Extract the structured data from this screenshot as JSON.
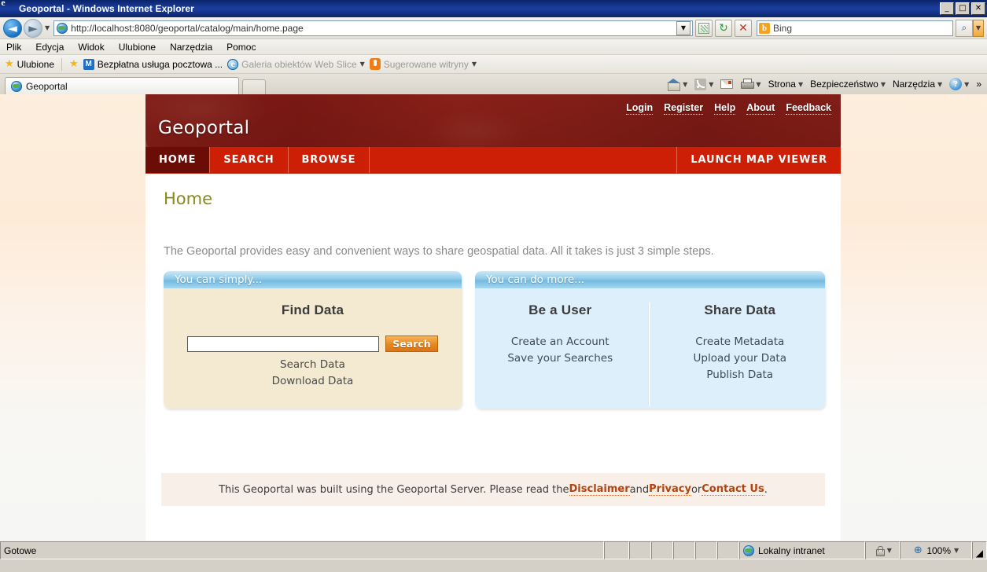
{
  "window": {
    "title": "Geoportal - Windows Internet Explorer",
    "icon": "ie-icon",
    "controls": {
      "minimize": "_",
      "maximize": "□",
      "close": "✕"
    }
  },
  "browser": {
    "address": {
      "url": "http://localhost:8080/geoportal/catalog/main/home.page",
      "dropdown_caret": "▼",
      "site_icon": "globe-icon"
    },
    "nav": {
      "back": "◄",
      "forward": "►",
      "history_caret": "▼"
    },
    "toolbuttons": {
      "compatibility": "compatibility-view-icon",
      "refresh": "↻",
      "stop": "✕"
    },
    "search": {
      "provider": "Bing",
      "provider_initial": "b",
      "go": "⌕",
      "dropdown_caret": "▼"
    },
    "menu": [
      "Plik",
      "Edycja",
      "Widok",
      "Ulubione",
      "Narzędzia",
      "Pomoc"
    ],
    "favorites_bar": {
      "favorites_label": "Ulubione",
      "add_label": "",
      "items": [
        {
          "label": "Bezpłatna usługa pocztowa ...",
          "icon": "msn-icon",
          "badge": "M",
          "dim": false,
          "caret": ""
        },
        {
          "label": "Galeria obiektów Web Slice",
          "icon": "ie-icon",
          "badge": "",
          "dim": true,
          "caret": "▼"
        },
        {
          "label": "Sugerowane witryny",
          "icon": "bulb-icon",
          "badge": "",
          "dim": true,
          "caret": "▼"
        }
      ]
    },
    "tabs": [
      {
        "label": "Geoportal",
        "icon": "globe-icon",
        "active": true
      }
    ],
    "new_tab_label": "",
    "command_bar": {
      "home": "home-icon",
      "feeds": "rss-icon",
      "mail": "mail-icon",
      "print": "print-icon",
      "caret": "▼",
      "page": "Strona",
      "safety": "Bezpieczeństwo",
      "tools": "Narzędzia",
      "help": "help-icon",
      "overflow": "»"
    }
  },
  "page": {
    "banner": {
      "brand": "Geoportal",
      "links": [
        "Login",
        "Register",
        "Help",
        "About",
        "Feedback"
      ]
    },
    "nav": {
      "items": [
        {
          "label": "HOME",
          "active": true
        },
        {
          "label": "SEARCH",
          "active": false
        },
        {
          "label": "BROWSE",
          "active": false
        }
      ],
      "launch": "LAUNCH MAP VIEWER"
    },
    "title": "Home",
    "intro": "The Geoportal provides easy and convenient ways to share geospatial data. All it takes is just 3 simple steps.",
    "panels": [
      {
        "id": "simply",
        "header": "You can simply...",
        "heading": "Find Data",
        "search_value": "",
        "search_placeholder": "",
        "search_button": "Search",
        "links": [
          "Search Data",
          "Download Data"
        ]
      },
      {
        "id": "more",
        "header": "You can do more...",
        "columns": [
          {
            "heading": "Be a User",
            "links": [
              "Create an Account",
              "Save your Searches"
            ]
          },
          {
            "heading": "Share Data",
            "links": [
              "Create Metadata",
              "Upload your Data",
              "Publish Data"
            ]
          }
        ]
      }
    ],
    "footer": {
      "text_before": "This Geoportal was built using the Geoportal Server. Please read the ",
      "link1": "Disclaimer",
      "text_mid1": " and ",
      "link2": "Privacy",
      "text_mid2": " or ",
      "link3": "Contact Us",
      "text_after": "."
    }
  },
  "statusbar": {
    "status": "Gotowe",
    "zone": "Lokalny intranet",
    "zone_icon": "intranet-globe-icon",
    "protected_icon": "lock-icon",
    "protected_caret": "▼",
    "zoom_icon": "zoom-icon",
    "zoom": "100%",
    "zoom_caret": "▼"
  },
  "colors": {
    "titlebar": "#0a246a",
    "nav_red": "#cc1f05",
    "nav_active_red": "#6b0d06",
    "page_title_olive": "#8a8a19",
    "panel_header_blue": "#8fcae8",
    "panel_cream": "#f3ead1",
    "panel_lightblue": "#ddeffb",
    "search_button_orange": "#e8871c",
    "footer_link": "#b5430b"
  }
}
